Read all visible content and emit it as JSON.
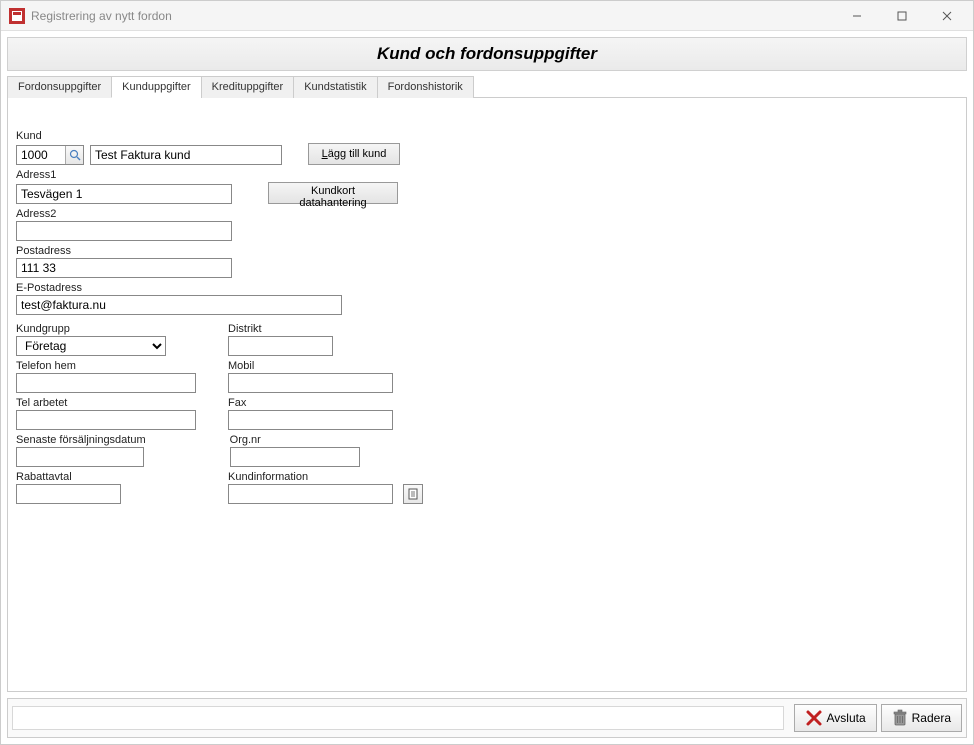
{
  "window": {
    "title": "Registrering av nytt fordon"
  },
  "header": {
    "title": "Kund och fordonsuppgifter"
  },
  "tabs": [
    {
      "label": "Fordonsuppgifter"
    },
    {
      "label": "Kunduppgifter"
    },
    {
      "label": "Kredituppgifter"
    },
    {
      "label": "Kundstatistik"
    },
    {
      "label": "Fordonshistorik"
    }
  ],
  "labels": {
    "kund": "Kund",
    "laggTillKund": "Lägg till kund",
    "adress1": "Adress1",
    "kundkortData": "Kundkort datahantering",
    "adress2": "Adress2",
    "postadress": "Postadress",
    "epostadress": "E-Postadress",
    "kundgrupp": "Kundgrupp",
    "distrikt": "Distrikt",
    "telefonHem": "Telefon hem",
    "mobil": "Mobil",
    "telArbetet": "Tel arbetet",
    "fax": "Fax",
    "senasteForsaljningsdatum": "Senaste försäljningsdatum",
    "orgnr": "Org.nr",
    "rabattavtal": "Rabattavtal",
    "kundinformation": "Kundinformation"
  },
  "values": {
    "kundId": "1000",
    "kundNamn": "Test Faktura kund",
    "adress1": "Tesvägen 1",
    "adress2": "",
    "postadress": "111 33",
    "epostadress": "test@faktura.nu",
    "kundgrupp": "Företag",
    "distrikt": "",
    "telefonHem": "",
    "mobil": "",
    "telArbetet": "",
    "fax": "",
    "senasteForsaljningsdatum": "",
    "orgnr": "",
    "rabattavtal": "",
    "kundinformation": ""
  },
  "kundgruppOptions": [
    "Företag"
  ],
  "footer": {
    "avsluta": "Avsluta",
    "radera": "Radera"
  }
}
